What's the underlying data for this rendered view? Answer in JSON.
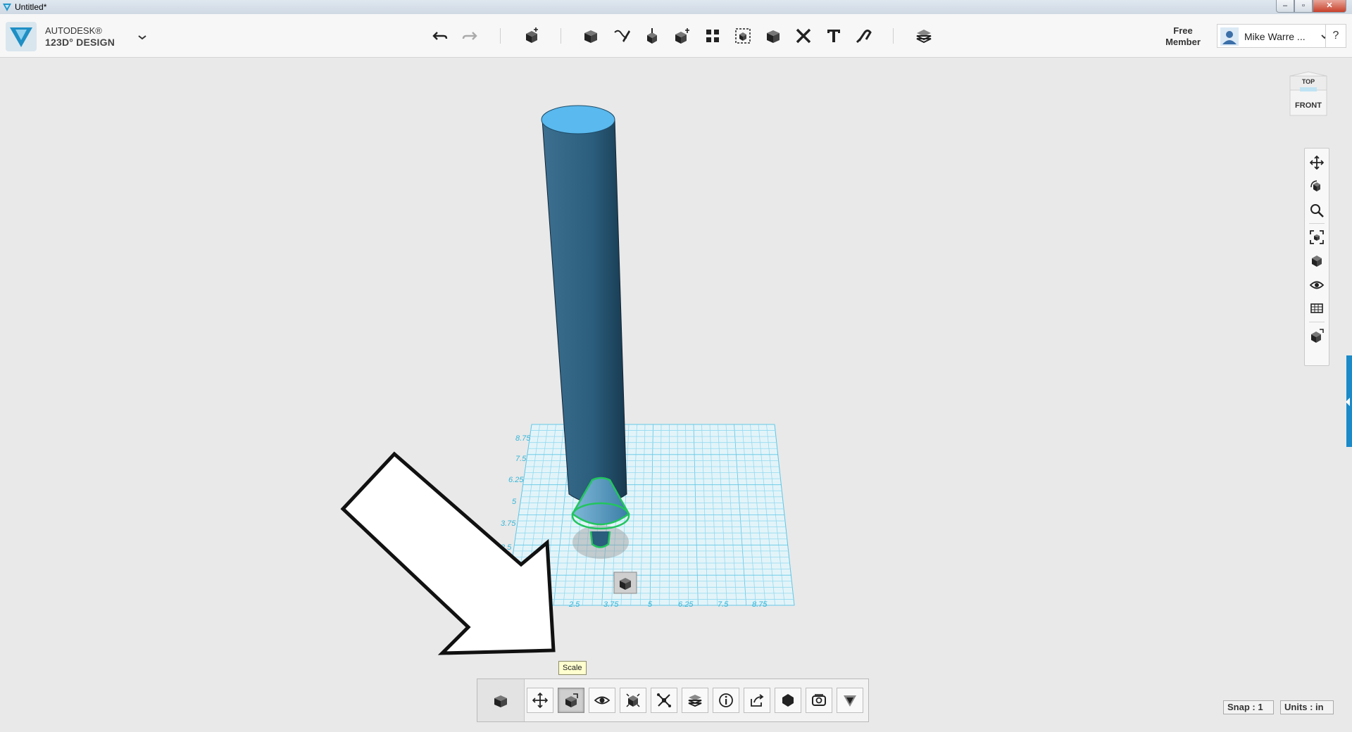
{
  "window": {
    "title": "Untitled*",
    "controls": {
      "minimize": "–",
      "maximize": "▫",
      "close": "✕"
    }
  },
  "header": {
    "brand_top": "AUTODESK®",
    "brand_bottom": "123D° DESIGN",
    "membership_line1": "Free",
    "membership_line2": "Member",
    "user_name": "Mike Warre ...",
    "help_label": "?",
    "toolbar_icons": [
      "undo-icon",
      "redo-icon",
      "transform-icon",
      "primitives-icon",
      "sketch-icon",
      "construct-icon",
      "modify-icon",
      "pattern-icon",
      "grouping-icon",
      "combine-icon",
      "measure-icon",
      "text-icon",
      "snap-icon",
      "materials-icon"
    ]
  },
  "viewcube": {
    "top_label": "TOP",
    "front_label": "FRONT"
  },
  "grid": {
    "y_labels": [
      "8.75",
      "7.5",
      "6.25",
      "5",
      "3.75",
      "2.5"
    ],
    "x_labels": [
      "2.5",
      "3.75",
      "5",
      "6.25",
      "7.5",
      "8.75"
    ]
  },
  "tooltip": {
    "text": "Scale"
  },
  "bottom_toolbar": {
    "active_tool": "Scale",
    "tools": [
      "move",
      "scale",
      "hide",
      "smart-scale",
      "tweak",
      "press-pull",
      "properties",
      "export",
      "material",
      "shell",
      "split-solid"
    ]
  },
  "status": {
    "snap": "Snap : 1",
    "units": "Units : in"
  },
  "colors": {
    "accent": "#1a8ac8",
    "cylinder": "#2c5c7a",
    "cylinder_top": "#5ab9ee",
    "grid": "#7fd3ec",
    "selection": "#22c55e"
  }
}
